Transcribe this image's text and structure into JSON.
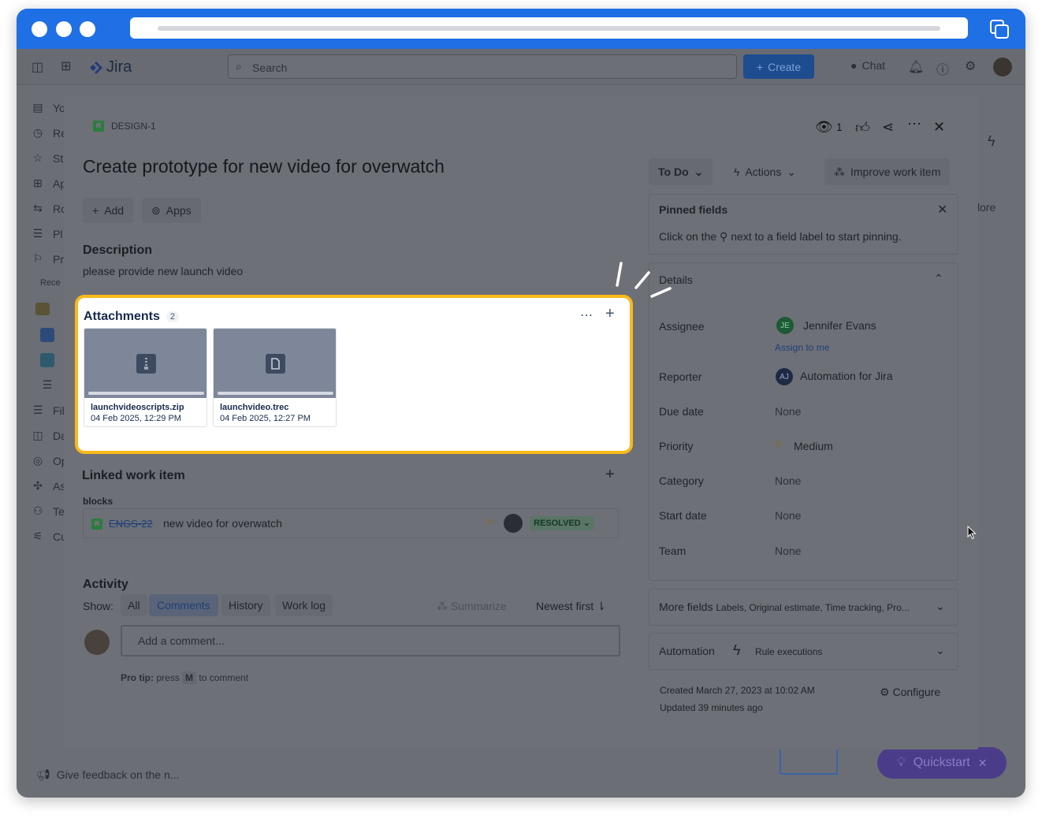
{
  "browser": {
    "tabs_icon": "tabs-icon"
  },
  "topnav": {
    "app_name": "Jira",
    "search_placeholder": "Search",
    "create_label": "Create",
    "chat_label": "Chat"
  },
  "sidebar": {
    "items": [
      {
        "label": "Yo",
        "icon": "person-icon"
      },
      {
        "label": "Re",
        "icon": "clock-icon"
      },
      {
        "label": "St",
        "icon": "star-icon"
      },
      {
        "label": "Ap",
        "icon": "apps-icon"
      },
      {
        "label": "Ro",
        "icon": "roadmap-icon"
      },
      {
        "label": "Pl",
        "icon": "plans-icon"
      },
      {
        "label": "Pr",
        "icon": "projects-icon"
      }
    ],
    "recent_label": "Rece",
    "lower_items": [
      {
        "label": "Fil",
        "icon": "filters-icon"
      },
      {
        "label": "Da",
        "icon": "dashboards-icon"
      },
      {
        "label": "Op",
        "icon": "operations-icon"
      },
      {
        "label": "As",
        "icon": "assets-icon"
      },
      {
        "label": "Te",
        "icon": "teams-icon"
      },
      {
        "label": "Cu",
        "icon": "customize-icon"
      }
    ],
    "feedback_label": "Give feedback on the n..."
  },
  "background": {
    "more_text": "lore",
    "quickstart_label": "Quickstart"
  },
  "modal": {
    "issue_key": "DESIGN-1",
    "title": "Create prototype for new video for overwatch",
    "add_label": "Add",
    "apps_label": "Apps",
    "watch_count": "1",
    "description_heading": "Description",
    "description_text": "please provide new launch video",
    "attachments": {
      "heading": "Attachments",
      "count": "2",
      "files": [
        {
          "name": "launchvideoscripts.zip",
          "date": "04 Feb 2025, 12:29 PM",
          "icon": "zip-file-icon"
        },
        {
          "name": "launchvideo.trec",
          "date": "04 Feb 2025, 12:27 PM",
          "icon": "document-file-icon"
        }
      ]
    },
    "linked": {
      "heading": "Linked work item",
      "relation": "blocks",
      "key": "ENGS-22",
      "summary": "new video for overwatch",
      "status": "RESOLVED"
    },
    "activity": {
      "heading": "Activity",
      "show_label": "Show:",
      "filters": [
        "All",
        "Comments",
        "History",
        "Work log"
      ],
      "active_filter": "Comments",
      "summarize_label": "Summarize",
      "sort_label": "Newest first",
      "comment_placeholder": "Add a comment...",
      "pro_tip_bold": "Pro tip:",
      "pro_tip_press": "press",
      "pro_tip_key": "M",
      "pro_tip_rest": "to comment"
    },
    "right": {
      "status_label": "To Do",
      "actions_label": "Actions",
      "improve_label": "Improve work item",
      "pinned_heading": "Pinned fields",
      "pinned_text_before": "Click on the",
      "pinned_text_after": "next to a field label to start pinning.",
      "details_heading": "Details",
      "fields": {
        "assignee_label": "Assignee",
        "assignee_value": "Jennifer Evans",
        "assignee_initials": "JE",
        "assign_to_me": "Assign to me",
        "reporter_label": "Reporter",
        "reporter_value": "Automation for Jira",
        "reporter_initials": "AJ",
        "due_label": "Due date",
        "due_value": "None",
        "priority_label": "Priority",
        "priority_value": "Medium",
        "category_label": "Category",
        "category_value": "None",
        "start_label": "Start date",
        "start_value": "None",
        "team_label": "Team",
        "team_value": "None"
      },
      "more_fields_label": "More fields",
      "more_fields_sub": "Labels, Original estimate, Time tracking, Pro...",
      "automation_label": "Automation",
      "rule_executions": "Rule executions",
      "created_text": "Created March 27, 2023 at 10:02 AM",
      "updated_text": "Updated 39 minutes ago",
      "configure_label": "Configure"
    }
  },
  "colors": {
    "titlebar": "#1f6fe5",
    "highlight_border": "#f8b91b",
    "link_blue": "#0c66e4"
  }
}
